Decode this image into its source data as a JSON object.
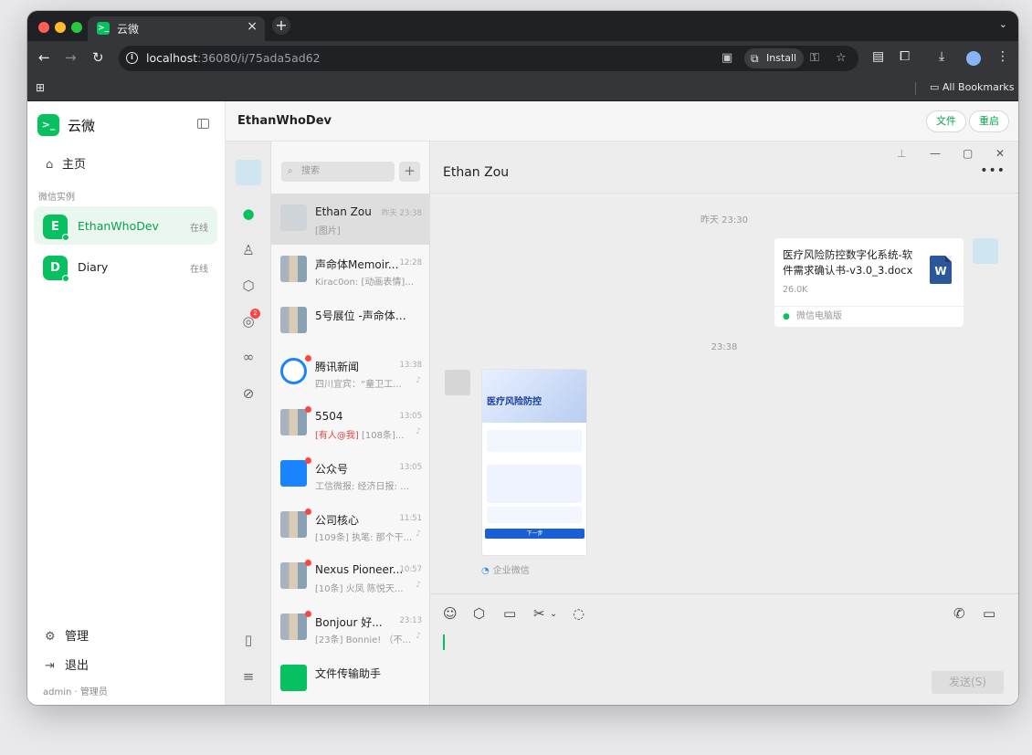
{
  "browser": {
    "tab_title": "云微",
    "tab_close": "×",
    "new_tab": "+",
    "url_host": "localhost",
    "url_rest": ":36080/i/75ada5ad62",
    "install_label": "Install",
    "bookmarks_label": "All Bookmarks"
  },
  "sidebar": {
    "brand": "云微",
    "home": "主页",
    "section_label": "微信实例",
    "instances": [
      {
        "initial": "E",
        "name": "EthanWhoDev",
        "status": "在线"
      },
      {
        "initial": "D",
        "name": "Diary",
        "status": "在线"
      }
    ],
    "manage": "管理",
    "logout": "退出",
    "user": "admin · 管理员"
  },
  "header": {
    "title": "EthanWhoDev",
    "file_btn": "文件",
    "restart_btn": "重启"
  },
  "wechat": {
    "rail_badge": "2",
    "search_placeholder": "搜索",
    "chats": [
      {
        "name": "Ethan Zou",
        "time": "昨天 23:38",
        "preview": "[图片]"
      },
      {
        "name": "声命体Memoir...",
        "time": "12:28",
        "preview": "Kirac0on: [动画表情] 一..."
      },
      {
        "name": "5号展位 -声命体Me...",
        "time": "",
        "preview": ""
      },
      {
        "name": "腾讯新闻",
        "time": "13:38",
        "preview": "四川宜宾：“童卫工..."
      },
      {
        "name": "5504",
        "time": "13:05",
        "preview_at": "[有人@我]",
        "preview": " [108条]..."
      },
      {
        "name": "公众号",
        "time": "13:05",
        "preview": "工信微报: 经济日报: 生..."
      },
      {
        "name": "公司核心",
        "time": "11:51",
        "preview": "[109条] 执笔: 那个干..."
      },
      {
        "name": "Nexus Pioneer...",
        "time": "10:57",
        "preview": "[10条] 火凤 陈悦天..."
      },
      {
        "name": "Bonjour 好...",
        "time": "23:13",
        "preview": "[23条] Bonnie! （不..."
      },
      {
        "name": "文件传输助手",
        "time": "",
        "preview": ""
      }
    ],
    "conversation": {
      "title": "Ethan Zou",
      "more": "•••",
      "timestamp_1": "昨天 23:30",
      "file_name": "医疗风险防控数字化系统-软件需求确认书-v3.0_3.docx",
      "file_size": "26.0K",
      "file_source": "微信电脑版",
      "timestamp_2": "23:38",
      "image_title": "医疗风险防控",
      "image_button": "下一步",
      "image_source": "企业微信",
      "send_label": "发送(S)"
    }
  }
}
